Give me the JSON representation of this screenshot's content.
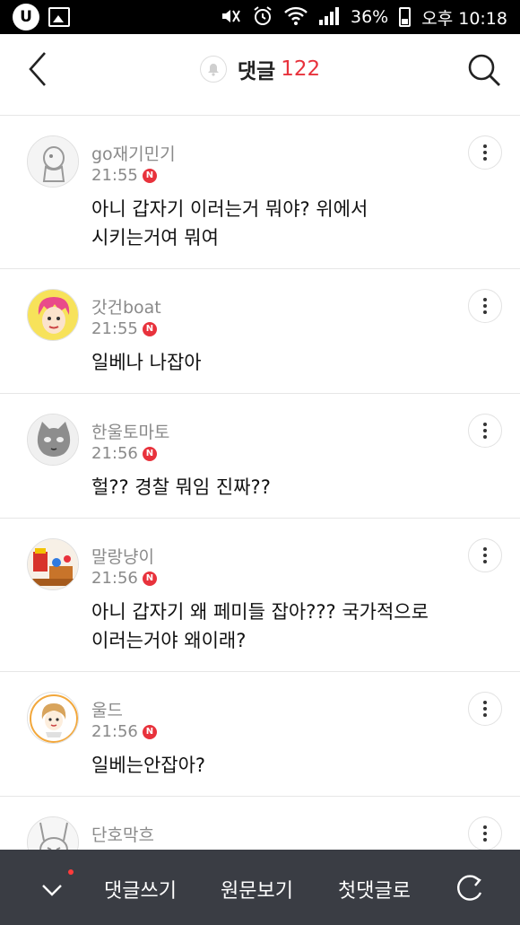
{
  "status_bar": {
    "left_icons": [
      "u-plus-icon",
      "gallery-icon"
    ],
    "right_icons": [
      "mute-icon",
      "alarm-icon",
      "wifi-icon",
      "signal-icon",
      "battery-icon"
    ],
    "battery": "36%",
    "time": "오후 10:18"
  },
  "header": {
    "title": "댓글",
    "count": "122",
    "accent_color": "#e8323c"
  },
  "comments": [
    {
      "nickname": "go재기민기",
      "time": "21:55",
      "badge": "N",
      "text_lines": [
        "아니 갑자기 이러는거 뭐야? 위에서",
        "시키는거여 뭐여"
      ],
      "avatar": "grey-figure-avatar"
    },
    {
      "nickname": "갓건boat",
      "time": "21:55",
      "badge": "N",
      "text_lines": [
        "일베나 나잡아"
      ],
      "avatar": "pink-hair-avatar"
    },
    {
      "nickname": "한울토마토",
      "time": "21:56",
      "badge": "N",
      "text_lines": [
        "헐?? 경찰 뭐임 진짜??"
      ],
      "avatar": "cat-avatar"
    },
    {
      "nickname": "말랑냥이",
      "time": "21:56",
      "badge": "N",
      "text_lines": [
        "아니 갑자기 왜 페미들 잡아??? 국가적으로",
        "이러는거야 왜이래?"
      ],
      "avatar": "toys-avatar"
    },
    {
      "nickname": "울드",
      "time": "21:56",
      "badge": "N",
      "text_lines": [
        "일베는안잡아?"
      ],
      "avatar": "drawn-girl-avatar"
    },
    {
      "nickname": "단호막흐",
      "time": "",
      "badge": "",
      "text_lines": [],
      "avatar": "rabbit-avatar"
    }
  ],
  "bottom_bar": {
    "write_label": "댓글쓰기",
    "original_label": "원문보기",
    "first_label": "첫댓글로"
  }
}
